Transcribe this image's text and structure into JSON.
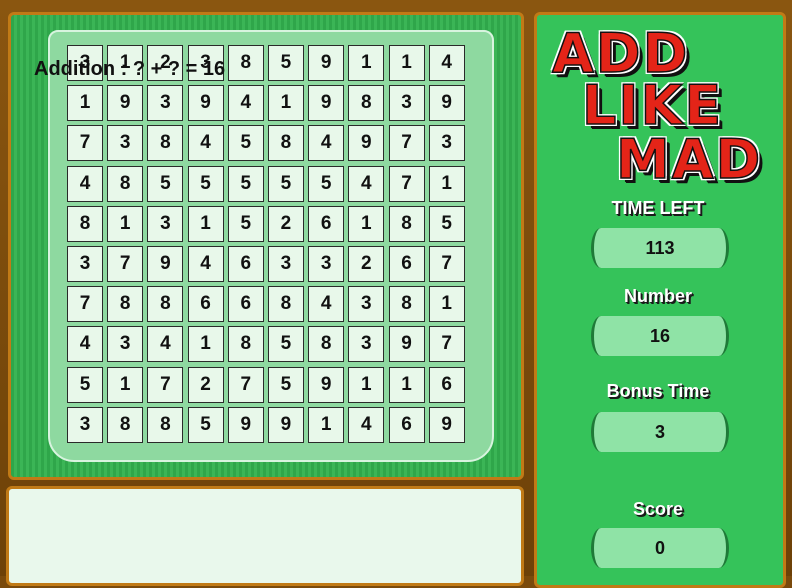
{
  "logo": {
    "line1": "ADD",
    "line2": "LIKE",
    "line3": "MAD"
  },
  "stats": {
    "time_left_label": "TIME LEFT",
    "time_left_value": "113",
    "number_label": "Number",
    "number_value": "16",
    "bonus_time_label": "Bonus Time",
    "bonus_time_value": "3",
    "score_label": "Score",
    "score_value": "0"
  },
  "equation": {
    "text": "Addition : ? + ? = 16"
  },
  "grid": [
    [
      3,
      1,
      2,
      3,
      8,
      5,
      9,
      1,
      1,
      4
    ],
    [
      1,
      9,
      3,
      9,
      4,
      1,
      9,
      8,
      3,
      9
    ],
    [
      7,
      3,
      8,
      4,
      5,
      8,
      4,
      9,
      7,
      3
    ],
    [
      4,
      8,
      5,
      5,
      5,
      5,
      5,
      4,
      7,
      1
    ],
    [
      8,
      1,
      3,
      1,
      5,
      2,
      6,
      1,
      8,
      5
    ],
    [
      3,
      7,
      9,
      4,
      6,
      3,
      3,
      2,
      6,
      7
    ],
    [
      7,
      8,
      8,
      6,
      6,
      8,
      4,
      3,
      8,
      1
    ],
    [
      4,
      3,
      4,
      1,
      8,
      5,
      8,
      3,
      9,
      7
    ],
    [
      5,
      1,
      7,
      2,
      7,
      5,
      9,
      1,
      1,
      6
    ],
    [
      3,
      8,
      8,
      5,
      9,
      9,
      1,
      4,
      6,
      9
    ]
  ],
  "colors": {
    "frame": "#7a4a0c",
    "panel_border": "#c17a16",
    "panel_green": "#35c35a",
    "board_inner": "#8ed9a0",
    "cell_bg": "#e8f8ea",
    "logo_red": "#e42418"
  }
}
